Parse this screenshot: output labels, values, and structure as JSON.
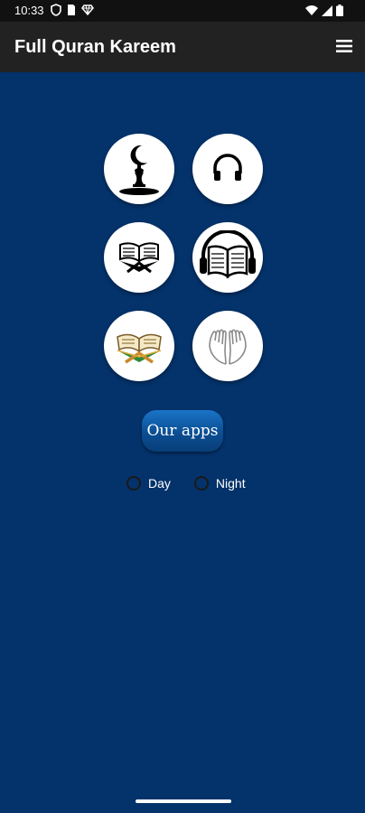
{
  "status_bar": {
    "time": "10:33"
  },
  "app_bar": {
    "title": "Full Quran Kareem"
  },
  "grid": [
    {
      "name": "qibla",
      "icon": "mosque-crescent-icon"
    },
    {
      "name": "audio",
      "icon": "headphones-icon"
    },
    {
      "name": "read",
      "icon": "quran-stand-icon"
    },
    {
      "name": "audiobook",
      "icon": "audiobook-icon"
    },
    {
      "name": "quran",
      "icon": "quran-book-icon"
    },
    {
      "name": "dua",
      "icon": "praying-hands-icon"
    }
  ],
  "our_apps": {
    "label": "Our apps"
  },
  "theme": {
    "day_label": "Day",
    "night_label": "Night"
  },
  "colors": {
    "background": "#04326a",
    "app_bar": "#222222",
    "status_bar": "#111111",
    "button_accent": "#0b4e93"
  }
}
